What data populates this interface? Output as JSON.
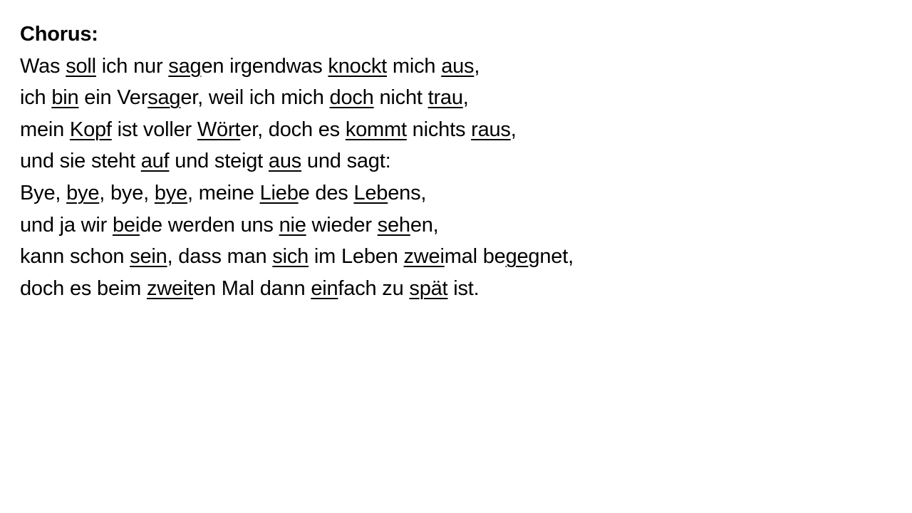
{
  "heading": "Chorus:",
  "lines": [
    [
      {
        "t": "Was ",
        "u": false
      },
      {
        "t": "soll",
        "u": true
      },
      {
        "t": " ich nur ",
        "u": false
      },
      {
        "t": "sag",
        "u": true
      },
      {
        "t": "en irgendwas ",
        "u": false
      },
      {
        "t": "knockt",
        "u": true
      },
      {
        "t": " mich ",
        "u": false
      },
      {
        "t": "aus",
        "u": true
      },
      {
        "t": ",",
        "u": false
      }
    ],
    [
      {
        "t": "ich ",
        "u": false
      },
      {
        "t": "bin",
        "u": true
      },
      {
        "t": " ein Ver",
        "u": false
      },
      {
        "t": "sag",
        "u": true
      },
      {
        "t": "er, weil ich mich ",
        "u": false
      },
      {
        "t": "doch",
        "u": true
      },
      {
        "t": " nicht ",
        "u": false
      },
      {
        "t": "trau",
        "u": true
      },
      {
        "t": ",",
        "u": false
      }
    ],
    [
      {
        "t": "mein ",
        "u": false
      },
      {
        "t": "Kopf",
        "u": true
      },
      {
        "t": " ist voller ",
        "u": false
      },
      {
        "t": "Wört",
        "u": true
      },
      {
        "t": "er, doch es ",
        "u": false
      },
      {
        "t": "kommt",
        "u": true
      },
      {
        "t": " nichts ",
        "u": false
      },
      {
        "t": "raus",
        "u": true
      },
      {
        "t": ",",
        "u": false
      }
    ],
    [
      {
        "t": "und sie steht ",
        "u": false
      },
      {
        "t": "auf",
        "u": true
      },
      {
        "t": " und steigt ",
        "u": false
      },
      {
        "t": "aus",
        "u": true
      },
      {
        "t": " und sagt:",
        "u": false
      }
    ],
    [
      {
        "t": "Bye, ",
        "u": false
      },
      {
        "t": "bye",
        "u": true
      },
      {
        "t": ", bye, ",
        "u": false
      },
      {
        "t": "bye",
        "u": true
      },
      {
        "t": ", meine ",
        "u": false
      },
      {
        "t": "Lieb",
        "u": true
      },
      {
        "t": "e des ",
        "u": false
      },
      {
        "t": "Leb",
        "u": true
      },
      {
        "t": "ens,",
        "u": false
      }
    ],
    [
      {
        "t": "und ja wir ",
        "u": false
      },
      {
        "t": "bei",
        "u": true
      },
      {
        "t": "de werden uns ",
        "u": false
      },
      {
        "t": "nie",
        "u": true
      },
      {
        "t": " wieder ",
        "u": false
      },
      {
        "t": "seh",
        "u": true
      },
      {
        "t": "en,",
        "u": false
      }
    ],
    [
      {
        "t": "kann schon ",
        "u": false
      },
      {
        "t": "sein",
        "u": true
      },
      {
        "t": ", dass man ",
        "u": false
      },
      {
        "t": "sich",
        "u": true
      },
      {
        "t": " im Leben ",
        "u": false
      },
      {
        "t": "zwei",
        "u": true
      },
      {
        "t": "mal be",
        "u": false
      },
      {
        "t": "ge",
        "u": true
      },
      {
        "t": "gnet,",
        "u": false
      }
    ],
    [
      {
        "t": "doch es beim ",
        "u": false
      },
      {
        "t": "zweit",
        "u": true
      },
      {
        "t": "en Mal dann ",
        "u": false
      },
      {
        "t": "ein",
        "u": true
      },
      {
        "t": "fach zu ",
        "u": false
      },
      {
        "t": "spät",
        "u": true
      },
      {
        "t": " ist.",
        "u": false
      }
    ]
  ]
}
